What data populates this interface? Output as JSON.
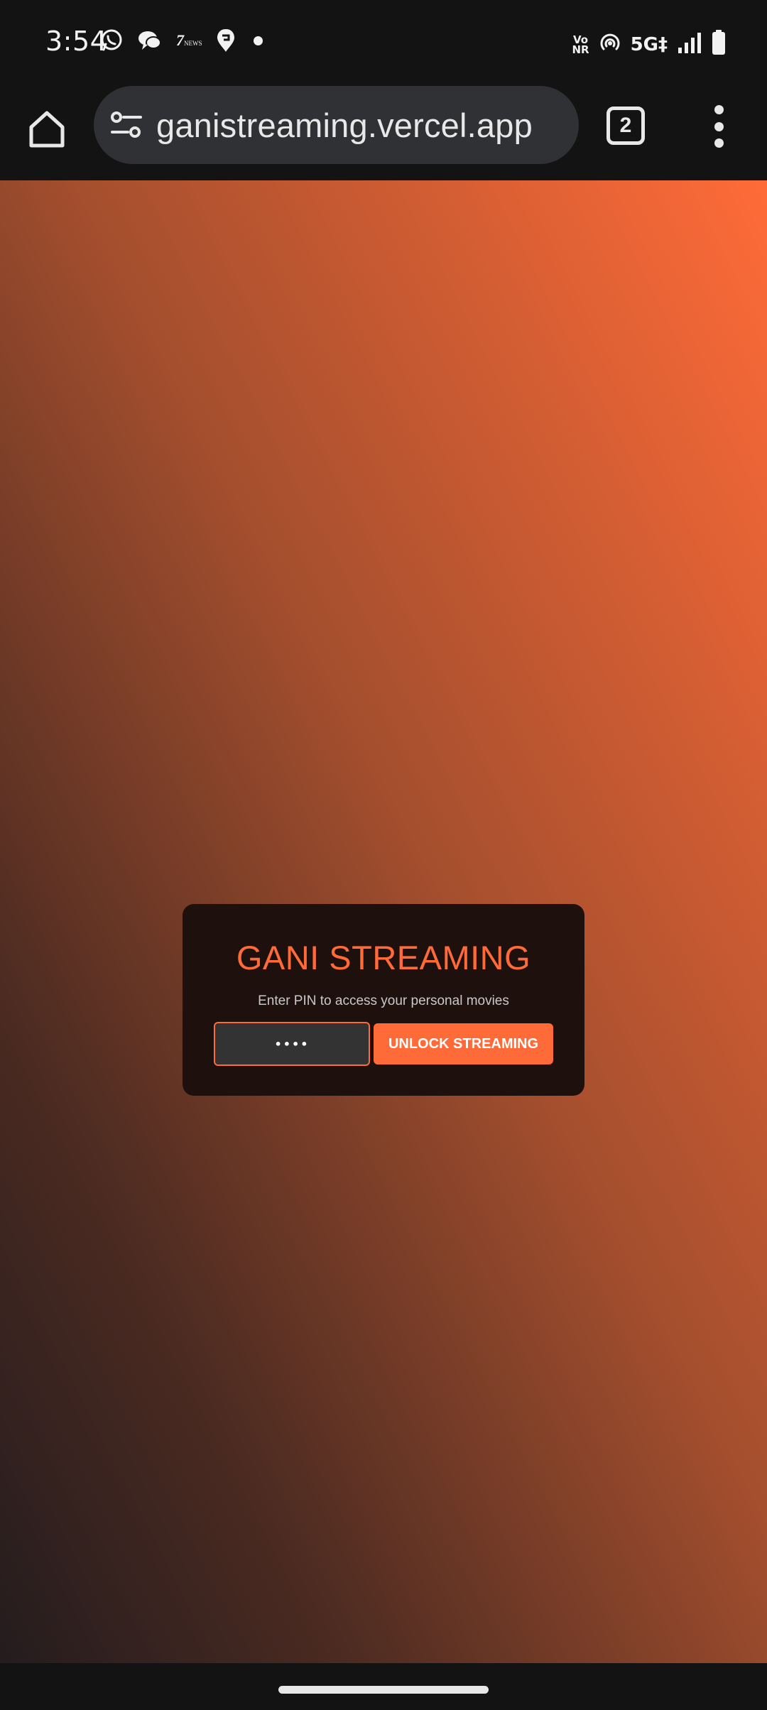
{
  "status_bar": {
    "time": "3:54",
    "notification_icons": [
      "whatsapp-icon",
      "chat-bubbles-icon",
      "7news-icon",
      "swiggy-icon",
      "more-notifications-dot"
    ],
    "news_label": "7",
    "news_sub": "NEWS",
    "vonr_top": "Vo",
    "vonr_bottom": "NR",
    "network": "5G‡",
    "system_icons": [
      "vonr-icon",
      "hotspot-icon",
      "signal-icon",
      "battery-icon"
    ]
  },
  "browser": {
    "url": "ganistreaming.vercel.app",
    "tab_count": "2",
    "icons": [
      "home-icon",
      "site-settings-icon",
      "tab-switcher-icon",
      "more-menu-icon"
    ]
  },
  "login": {
    "title": "GANI STREAMING",
    "subtitle": "Enter PIN to access your personal movies",
    "pin_value": "••••",
    "button_label": "UNLOCK STREAMING"
  },
  "colors": {
    "accent": "#ff6b38",
    "card_bg": "#1e100d",
    "input_bg": "#333333",
    "chrome_bg": "#131313",
    "url_bar_bg": "#303134"
  }
}
